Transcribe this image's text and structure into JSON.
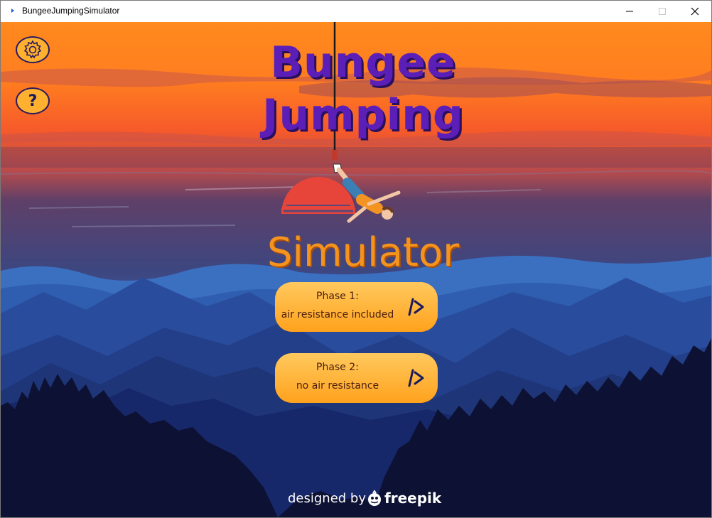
{
  "window": {
    "title": "BungeeJumpingSimulator"
  },
  "title": {
    "line1": "Bungee",
    "line2": "Jumping",
    "line3": "Simulator"
  },
  "buttons": {
    "phase1": {
      "line1": "Phase 1:",
      "line2": "air resistance included"
    },
    "phase2": {
      "line1": "Phase 2:",
      "line2": "no air resistance"
    }
  },
  "help_label": "?",
  "credit": {
    "prefix": "designed by",
    "brand": "freepik"
  },
  "icons": {
    "settings": "gear-icon",
    "help": "question-mark-icon",
    "play": "play-arrow-icon",
    "window_minimize": "minimize-icon",
    "window_maximize": "maximize-icon",
    "window_close": "close-icon"
  },
  "colors": {
    "title_purple": "#5b1fb8",
    "title_orange": "#f4931e",
    "button_orange": "#ffa21d",
    "sky_top": "#ff8a1e",
    "night_blue": "#0d1133"
  }
}
